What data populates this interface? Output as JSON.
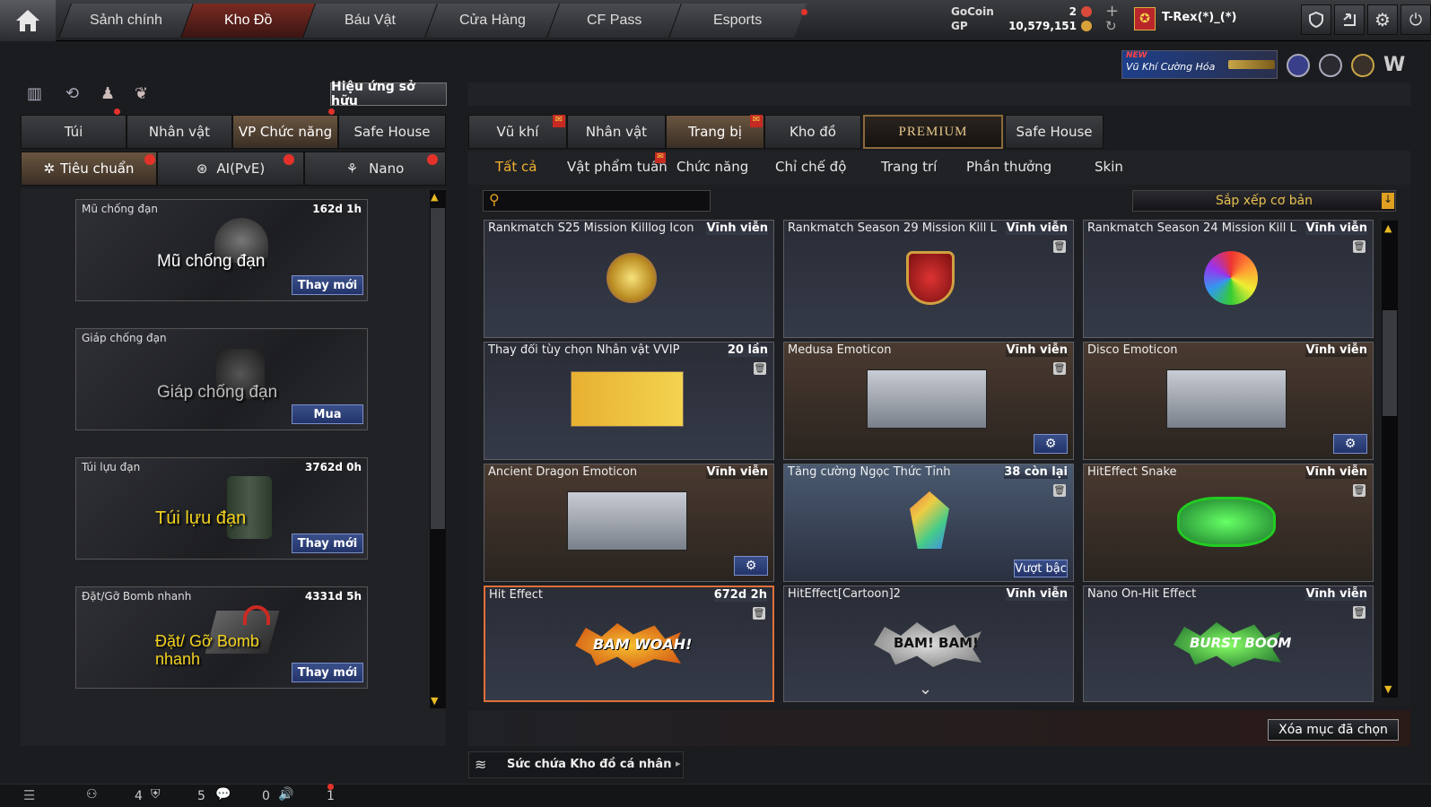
{
  "nav": {
    "tabs": [
      "Sảnh chính",
      "Kho Đồ",
      "Báu Vật",
      "Cửa Hàng",
      "CF Pass",
      "Esports"
    ]
  },
  "wallet": {
    "gocoin_label": "GoCoin",
    "gp_label": "GP",
    "gocoin_value": "2",
    "gp_value": "10,579,151"
  },
  "user": {
    "name": "T-Rex(*)_(*)"
  },
  "banner": {
    "new": "NEW",
    "text": "Vũ Khí Cường Hóa"
  },
  "left": {
    "effect_button": "Hiệu ứng sở hữu",
    "tabs": [
      "Túi",
      "Nhân vật",
      "VP Chức năng",
      "Safe House"
    ],
    "subtabs": [
      "Tiêu chuẩn",
      "AI(PvE)",
      "Nano"
    ],
    "cards": [
      {
        "title": "Mũ chống đạn",
        "time": "162d 1h",
        "big": "Mũ chống đạn",
        "button": "Thay mới"
      },
      {
        "title": "Giáp chống đạn",
        "time": "",
        "big": "Giáp chống đạn",
        "button": "Mua"
      },
      {
        "title": "Túi lựu đạn",
        "time": "3762d 0h",
        "big": "Túi lựu đạn",
        "button": "Thay mới"
      },
      {
        "title": "Đặt/Gỡ Bomb nhanh",
        "time": "4331d 5h",
        "big": "Đặt/ Gỡ Bomb nhanh",
        "button": "Thay mới"
      }
    ]
  },
  "right": {
    "tabs": [
      "Vũ khí",
      "Nhân vật",
      "Trang bị",
      "Kho đồ",
      "PREMIUM",
      "Safe House"
    ],
    "subtabs": [
      "Tất cả",
      "Vật phẩm tuần",
      "Chức năng",
      "Chỉ chế độ",
      "Trang trí",
      "Phần thưởng",
      "Skin"
    ],
    "search_placeholder": "",
    "sort": "Sắp xếp cơ bản",
    "items": [
      {
        "title": "Rankmatch S25 Mission Killlog Icon",
        "right": "Vĩnh viễn"
      },
      {
        "title": "Rankmatch Season 29 Mission Kill L",
        "right": "Vĩnh viễn"
      },
      {
        "title": "Rankmatch Season 24 Mission Kill L",
        "right": "Vĩnh viễn"
      },
      {
        "title": "Thay đổi tùy chọn Nhân vật VVIP",
        "right": "20 lần"
      },
      {
        "title": "Medusa Emoticon",
        "right": "Vĩnh viễn"
      },
      {
        "title": "Disco Emoticon",
        "right": "Vĩnh viễn"
      },
      {
        "title": "Ancient Dragon Emoticon",
        "right": "Vĩnh viễn"
      },
      {
        "title": "Tăng cường Ngọc Thức Tỉnh",
        "right": "38 còn lại",
        "tag": "Vượt bậc"
      },
      {
        "title": "HitEffect Snake",
        "right": "Vĩnh viễn"
      },
      {
        "title": "Hit Effect",
        "right": "672d 2h",
        "art": "BAM WOAH!"
      },
      {
        "title": "HitEffect[Cartoon]2",
        "right": "Vĩnh viễn",
        "art": "BAM! BAM!"
      },
      {
        "title": "Nano On-Hit Effect",
        "right": "Vĩnh viễn",
        "art": "BURST BOOM"
      }
    ],
    "delete_button": "Xóa mục đã chọn",
    "capacity": "Sức chứa Kho đồ cá nhân"
  },
  "status": {
    "counts": [
      "4",
      "5",
      "0",
      "1"
    ]
  }
}
